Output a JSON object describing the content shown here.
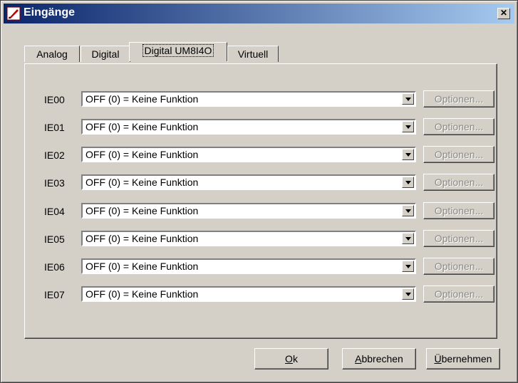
{
  "window": {
    "title": "Eingänge",
    "close_label": "✕"
  },
  "tabs": [
    {
      "label": "Analog"
    },
    {
      "label": "Digital"
    },
    {
      "label": "Digital UM8I4O"
    },
    {
      "label": "Virtuell"
    }
  ],
  "active_tab": "Digital UM8I4O",
  "rows": [
    {
      "label": "IE00",
      "value": "OFF (0) = Keine Funktion",
      "options": "Optionen..."
    },
    {
      "label": "IE01",
      "value": "OFF (0) = Keine Funktion",
      "options": "Optionen..."
    },
    {
      "label": "IE02",
      "value": "OFF (0) = Keine Funktion",
      "options": "Optionen..."
    },
    {
      "label": "IE03",
      "value": "OFF (0) = Keine Funktion",
      "options": "Optionen..."
    },
    {
      "label": "IE04",
      "value": "OFF (0) = Keine Funktion",
      "options": "Optionen..."
    },
    {
      "label": "IE05",
      "value": "OFF (0) = Keine Funktion",
      "options": "Optionen..."
    },
    {
      "label": "IE06",
      "value": "OFF (0) = Keine Funktion",
      "options": "Optionen..."
    },
    {
      "label": "IE07",
      "value": "OFF (0) = Keine Funktion",
      "options": "Optionen..."
    }
  ],
  "buttons": {
    "ok_mnemonic": "O",
    "ok_rest": "k",
    "cancel_mnemonic": "A",
    "cancel_rest": "bbrechen",
    "apply_mnemonic": "Ü",
    "apply_rest": "bernehmen"
  }
}
